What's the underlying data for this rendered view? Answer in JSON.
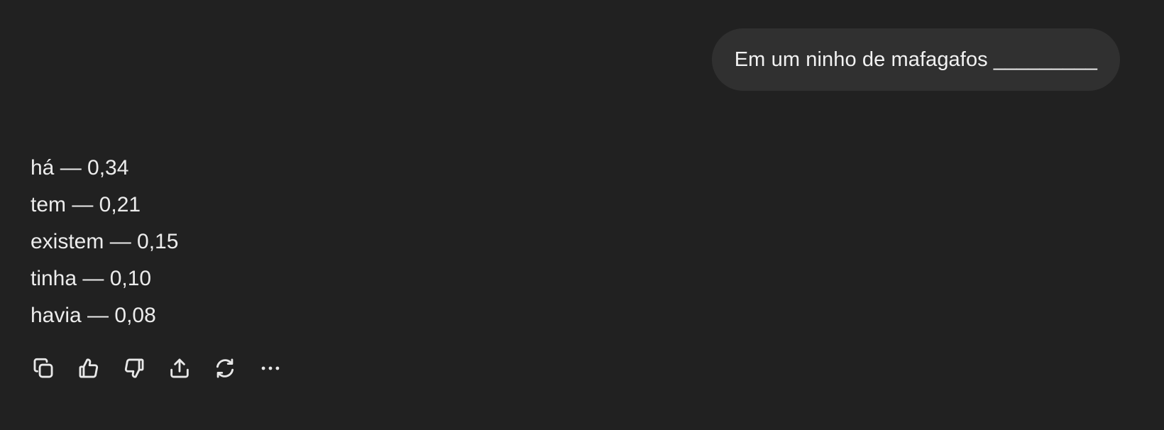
{
  "conversation": {
    "user_message": "Em um ninho de mafagafos _________",
    "assistant_lines": [
      "há — 0,34",
      "tem — 0,21",
      "existem — 0,15",
      "tinha — 0,10",
      "havia — 0,08"
    ]
  },
  "actions": [
    {
      "icon": "copy-icon"
    },
    {
      "icon": "thumbs-up-icon"
    },
    {
      "icon": "thumbs-down-icon"
    },
    {
      "icon": "share-icon"
    },
    {
      "icon": "regenerate-icon"
    },
    {
      "icon": "more-icon"
    }
  ],
  "colors": {
    "background": "#212121",
    "user_bubble": "#303030",
    "text": "#ececec"
  }
}
